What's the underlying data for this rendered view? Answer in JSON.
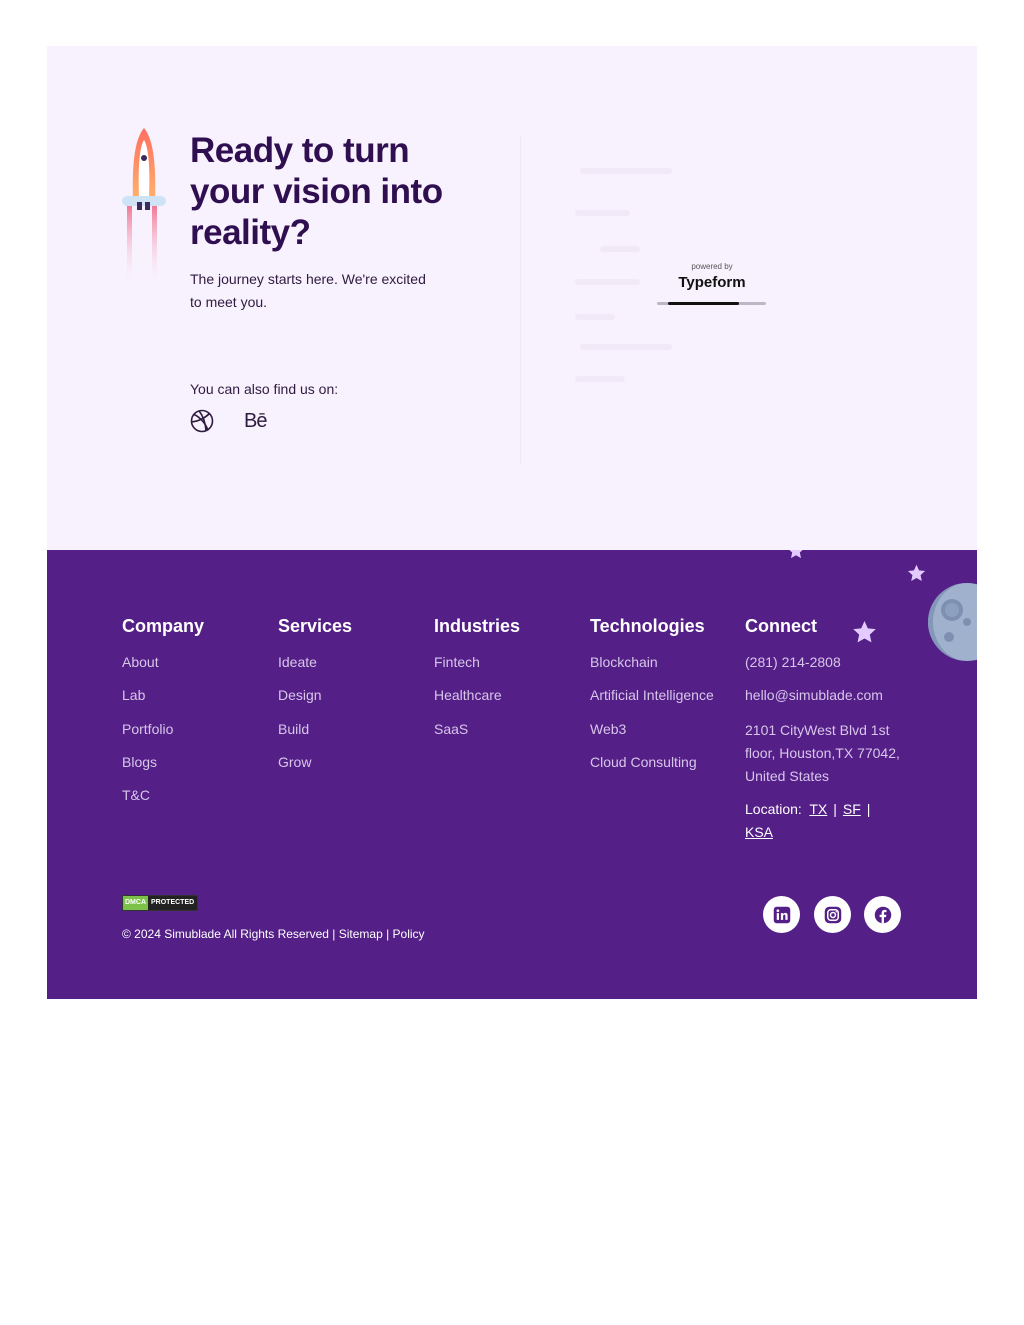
{
  "cta": {
    "title": "Ready to turn your vision into reality?",
    "subtitle": "The journey starts here. We're excited to meet you.",
    "find_us": "You can also find us on:",
    "behance_label": "Bē",
    "icons": [
      "rocket-icon",
      "dribbble-icon",
      "behance-icon"
    ]
  },
  "typeform": {
    "powered_by": "powered by",
    "brand": "Typeform",
    "progress": 0.65
  },
  "footer": {
    "columns": [
      {
        "heading": "Company",
        "links": [
          "About",
          "Lab",
          "Portfolio",
          "Blogs",
          "T&C"
        ]
      },
      {
        "heading": "Services",
        "links": [
          "Ideate",
          "Design",
          "Build",
          "Grow"
        ]
      },
      {
        "heading": "Industries",
        "links": [
          "Fintech",
          "Healthcare",
          "SaaS"
        ]
      },
      {
        "heading": "Technologies",
        "links": [
          "Blockchain",
          "Artificial Intelligence",
          "Web3",
          "Cloud Consulting"
        ]
      }
    ],
    "connect": {
      "heading": "Connect",
      "phone": "(281) 214-2808",
      "email": "hello@simublade.com",
      "address": "2101 CityWest Blvd 1st floor, Houston,TX 77042, United States",
      "location_label": "Location:",
      "locations": [
        "TX",
        "SF",
        "KSA"
      ]
    },
    "dmca": {
      "left": "DMCA",
      "right": "PROTECTED"
    },
    "copyright": "© 2024 Simublade All Rights Reserved | Sitemap | Policy",
    "social": [
      "linkedin-icon",
      "instagram-icon",
      "facebook-icon"
    ]
  },
  "colors": {
    "cta_bg": "#f8f1fe",
    "heading": "#2f0f50",
    "footer_bg": "#541f87",
    "link": "#d8c6ea",
    "star": "#e3cbff"
  }
}
